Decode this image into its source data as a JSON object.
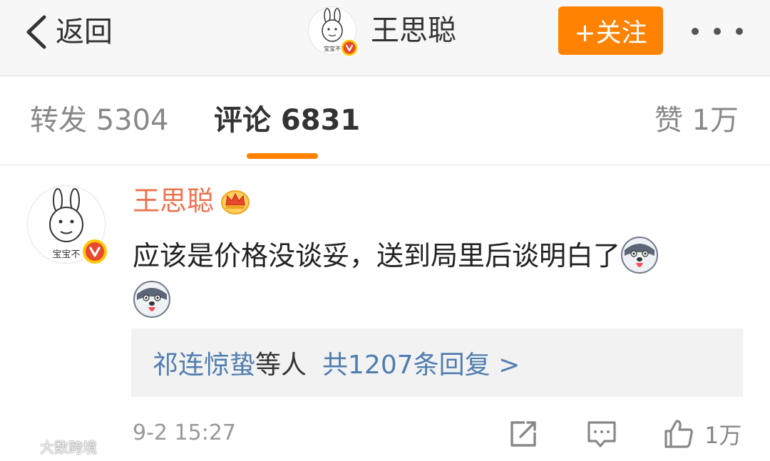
{
  "header": {
    "back_label": "返回",
    "title": "王思聪",
    "avatar_caption": "宝宝不",
    "follow_label": "+关注"
  },
  "tabs": {
    "repost": "转发 5304",
    "comment": "评论 6831",
    "like": "赞 1万"
  },
  "comment": {
    "author": "王思聪",
    "avatar_caption": "宝宝不",
    "text": "应该是价格没谈妥，送到局里后谈明白了",
    "replies_users": "祁连惊蛰",
    "replies_sep": "等人",
    "replies_count": "共1207条回复 >",
    "timestamp": "9-2 15:27",
    "like_count": "1万"
  },
  "watermark": "大数跨境",
  "colors": {
    "accent": "#ff8200",
    "author": "#eb7350",
    "link": "#507daf"
  }
}
